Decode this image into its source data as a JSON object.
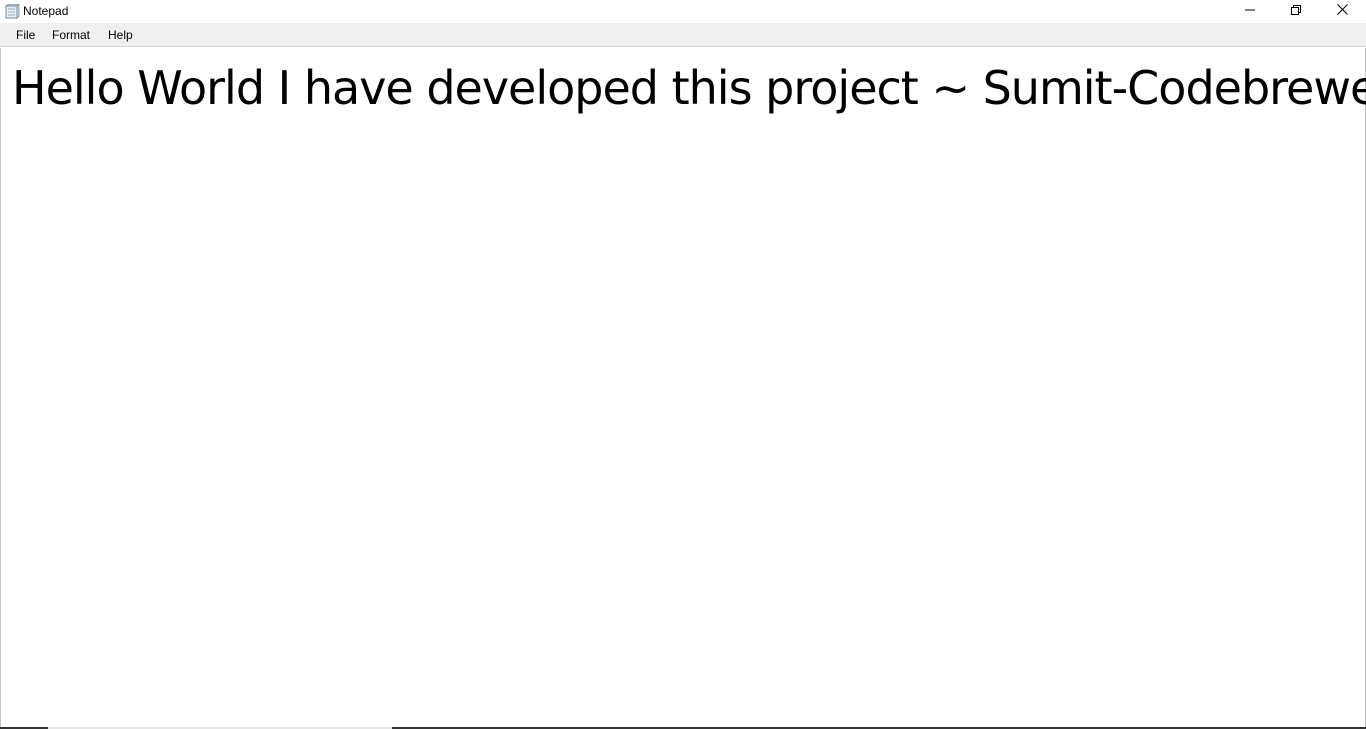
{
  "window": {
    "title": "Notepad",
    "app_icon": "notepad-icon",
    "caption_buttons": {
      "minimize": "minimize-icon",
      "maximize": "restore-icon",
      "close": "close-icon"
    }
  },
  "menu": {
    "items": [
      {
        "label": "File"
      },
      {
        "label": "Format"
      },
      {
        "label": "Help"
      }
    ]
  },
  "editor": {
    "content": "Hello World I have developed this project ~ Sumit-Codebrewer"
  },
  "colors": {
    "menubar_bg": "#f0f0f0",
    "editor_bg": "#ffffff",
    "text": "#000000"
  }
}
